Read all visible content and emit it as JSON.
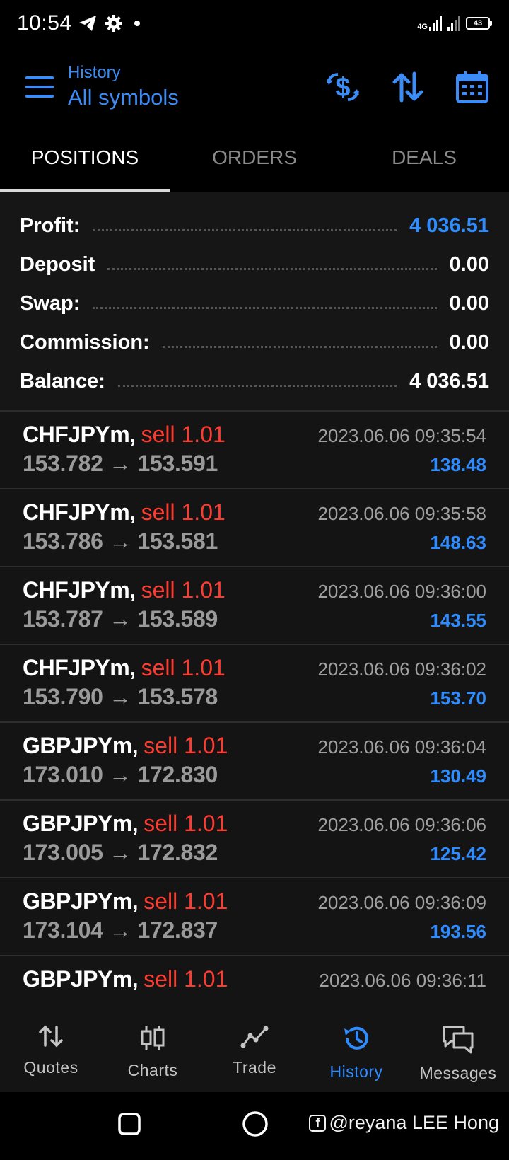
{
  "status_bar": {
    "time": "10:54",
    "network_label": "4G",
    "battery_level": "43",
    "icons": [
      "telegram-icon",
      "gear-icon",
      "dot-icon",
      "signal-icon",
      "battery-icon"
    ]
  },
  "app_bar": {
    "title_small": "History",
    "title_big": "All symbols",
    "icons": [
      "menu-icon",
      "currency-filter-icon",
      "sort-icon",
      "calendar-icon"
    ],
    "accent": "#3d8cf5"
  },
  "tabs": [
    {
      "label": "POSITIONS",
      "active": true
    },
    {
      "label": "ORDERS",
      "active": false
    },
    {
      "label": "DEALS",
      "active": false
    }
  ],
  "summary": [
    {
      "label": "Profit:",
      "value": "4 036.51",
      "highlight": true
    },
    {
      "label": "Deposit",
      "value": "0.00",
      "highlight": false
    },
    {
      "label": "Swap:",
      "value": "0.00",
      "highlight": false
    },
    {
      "label": "Commission:",
      "value": "0.00",
      "highlight": false
    },
    {
      "label": "Balance:",
      "value": "4 036.51",
      "highlight": false
    }
  ],
  "positions": [
    {
      "symbol": "CHFJPYm,",
      "side": "sell 1.01",
      "time": "2023.06.06 09:35:54",
      "prices": "153.782 → 153.591",
      "profit": "138.48"
    },
    {
      "symbol": "CHFJPYm,",
      "side": "sell 1.01",
      "time": "2023.06.06 09:35:58",
      "prices": "153.786 → 153.581",
      "profit": "148.63"
    },
    {
      "symbol": "CHFJPYm,",
      "side": "sell 1.01",
      "time": "2023.06.06 09:36:00",
      "prices": "153.787 → 153.589",
      "profit": "143.55"
    },
    {
      "symbol": "CHFJPYm,",
      "side": "sell 1.01",
      "time": "2023.06.06 09:36:02",
      "prices": "153.790 → 153.578",
      "profit": "153.70"
    },
    {
      "symbol": "GBPJPYm,",
      "side": "sell 1.01",
      "time": "2023.06.06 09:36:04",
      "prices": "173.010 → 172.830",
      "profit": "130.49"
    },
    {
      "symbol": "GBPJPYm,",
      "side": "sell 1.01",
      "time": "2023.06.06 09:36:06",
      "prices": "173.005 → 172.832",
      "profit": "125.42"
    },
    {
      "symbol": "GBPJPYm,",
      "side": "sell 1.01",
      "time": "2023.06.06 09:36:09",
      "prices": "173.104 → 172.837",
      "profit": "193.56"
    },
    {
      "symbol": "GBPJPYm,",
      "side": "sell 1.01",
      "time": "2023.06.06 09:36:11",
      "prices": "",
      "profit": ""
    }
  ],
  "bottom_nav": [
    {
      "label": "Quotes",
      "icon": "quotes-icon",
      "active": false
    },
    {
      "label": "Charts",
      "icon": "charts-icon",
      "active": false
    },
    {
      "label": "Trade",
      "icon": "trade-icon",
      "active": false
    },
    {
      "label": "History",
      "icon": "history-icon",
      "active": true
    },
    {
      "label": "Messages",
      "icon": "messages-icon",
      "active": false
    }
  ],
  "watermark": "@reyana LEE Hong",
  "colors": {
    "profit_blue": "#2f8cff",
    "sell_red": "#ff3b30",
    "row_bg": "#141414"
  }
}
